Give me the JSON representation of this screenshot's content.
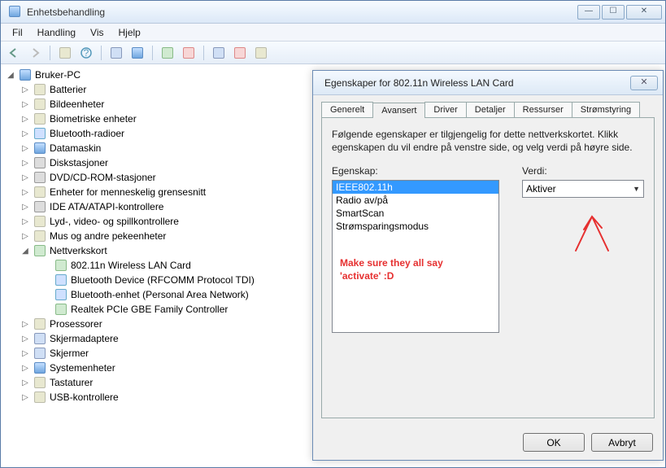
{
  "window": {
    "title": "Enhetsbehandling",
    "menus": [
      "Fil",
      "Handling",
      "Vis",
      "Hjelp"
    ],
    "win_buttons": {
      "min": "—",
      "max": "☐",
      "close": "✕"
    }
  },
  "toolbar_icons": [
    "back",
    "forward",
    "|",
    "list",
    "help",
    "|",
    "screen",
    "device",
    "|",
    "refresh",
    "stop",
    "|",
    "scan",
    "remove",
    "add"
  ],
  "tree": {
    "root": "Bruker-PC",
    "categories": [
      {
        "label": "Batterier",
        "icon": "generic"
      },
      {
        "label": "Bildeenheter",
        "icon": "generic"
      },
      {
        "label": "Biometriske enheter",
        "icon": "generic"
      },
      {
        "label": "Bluetooth-radioer",
        "icon": "bt"
      },
      {
        "label": "Datamaskin",
        "icon": "computer"
      },
      {
        "label": "Diskstasjoner",
        "icon": "drive"
      },
      {
        "label": "DVD/CD-ROM-stasjoner",
        "icon": "drive"
      },
      {
        "label": "Enheter for menneskelig grensesnitt",
        "icon": "generic"
      },
      {
        "label": "IDE ATA/ATAPI-kontrollere",
        "icon": "drive"
      },
      {
        "label": "Lyd-, video- og spillkontrollere",
        "icon": "generic"
      },
      {
        "label": "Mus og andre pekeenheter",
        "icon": "generic"
      },
      {
        "label": "Nettverkskort",
        "icon": "net",
        "expanded": true,
        "children": [
          {
            "label": "802.11n Wireless LAN Card",
            "icon": "net"
          },
          {
            "label": "Bluetooth Device (RFCOMM Protocol TDI)",
            "icon": "bt"
          },
          {
            "label": "Bluetooth-enhet (Personal Area Network)",
            "icon": "bt"
          },
          {
            "label": "Realtek PCIe GBE Family Controller",
            "icon": "net"
          }
        ]
      },
      {
        "label": "Prosessorer",
        "icon": "generic"
      },
      {
        "label": "Skjermadaptere",
        "icon": "monitor"
      },
      {
        "label": "Skjermer",
        "icon": "monitor"
      },
      {
        "label": "Systemenheter",
        "icon": "computer"
      },
      {
        "label": "Tastaturer",
        "icon": "generic"
      },
      {
        "label": "USB-kontrollere",
        "icon": "generic"
      }
    ]
  },
  "dialog": {
    "title": "Egenskaper for 802.11n Wireless LAN Card",
    "close": "✕",
    "tabs": [
      "Generelt",
      "Avansert",
      "Driver",
      "Detaljer",
      "Ressurser",
      "Strømstyring"
    ],
    "active_tab_index": 1,
    "description": "Følgende egenskaper er tilgjengelig for dette nettverkskortet. Klikk egenskapen du vil endre på venstre side, og velg verdi på høyre side.",
    "property_label": "Egenskap:",
    "value_label": "Verdi:",
    "properties": [
      "IEEE802.11h",
      "Radio av/på",
      "SmartScan",
      "Strømsparingsmodus"
    ],
    "selected_property_index": 0,
    "value_selected": "Aktiver",
    "ok": "OK",
    "cancel": "Avbryt"
  },
  "annotation": {
    "line1": "Make sure they all say",
    "line2": "'activate' :D"
  }
}
